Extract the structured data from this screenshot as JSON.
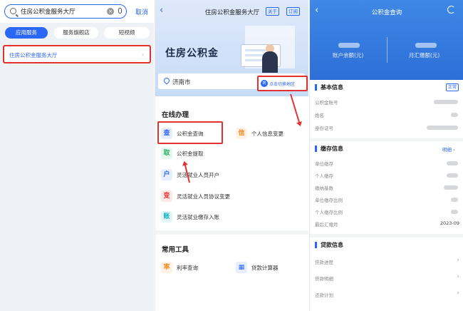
{
  "screen1": {
    "search_text": "住房公积金服务大厅",
    "cancel": "取消",
    "tabs": [
      {
        "label": "应用服务",
        "active": true
      },
      {
        "label": "服务旗舰店",
        "active": false
      },
      {
        "label": "短视频",
        "active": false
      }
    ],
    "result_title": "住房公积金服务大厅"
  },
  "screen2": {
    "title": "住房公积金服务大厅",
    "btn_about": "关于",
    "btn_subscribe": "订阅",
    "banner_title": "住房公积金",
    "city": "济南市",
    "switch_region": "点击切换地区",
    "switch_icon": "筑",
    "online_title": "在线办理",
    "services": [
      {
        "icon": "查",
        "label": "公积金查询",
        "color": "#2b67f6",
        "bg": "#e7efff"
      },
      {
        "icon": "信",
        "label": "个人信息变更",
        "color": "#f08a24",
        "bg": "#fff1e3"
      },
      {
        "icon": "取",
        "label": "公积金提取",
        "color": "#27ae60",
        "bg": "#e5f6ec"
      },
      {
        "icon": "户",
        "label": "灵活就业人员开户",
        "color": "#2b67f6",
        "bg": "#e7efff"
      },
      {
        "icon": "变",
        "label": "灵活就业人员协议变更",
        "color": "#e3312f",
        "bg": "#fde8e8"
      },
      {
        "icon": "账",
        "label": "灵活就业缴存入账",
        "color": "#16b3c9",
        "bg": "#e3f7fa"
      }
    ],
    "tools_title": "常用工具",
    "tools": [
      {
        "icon": "率",
        "label": "利率查询",
        "color": "#f08a24",
        "bg": "#fff1e3"
      },
      {
        "icon": "▦",
        "label": "贷款计算器",
        "color": "#2b67f6",
        "bg": "#e7efff"
      }
    ]
  },
  "screen3": {
    "title": "公积金查询",
    "balance_label": "账户余额(元)",
    "monthly_label": "月汇缴额(元)",
    "basic_title": "基本信息",
    "basic_badge": "正常",
    "basic_rows": [
      "公积金账号",
      "姓名",
      "身份证号"
    ],
    "deposit_title": "缴存信息",
    "deposit_detail": "明细 ›",
    "deposit_rows": [
      "单位缴存",
      "个人缴存",
      "缴纳基数",
      "单位缴存比例",
      "个人缴存比例",
      "最后汇缴月"
    ],
    "last_month": "2023-09",
    "loan_title": "贷款信息",
    "loan_rows": [
      "贷款进度",
      "贷款明细",
      "还款计划"
    ]
  }
}
